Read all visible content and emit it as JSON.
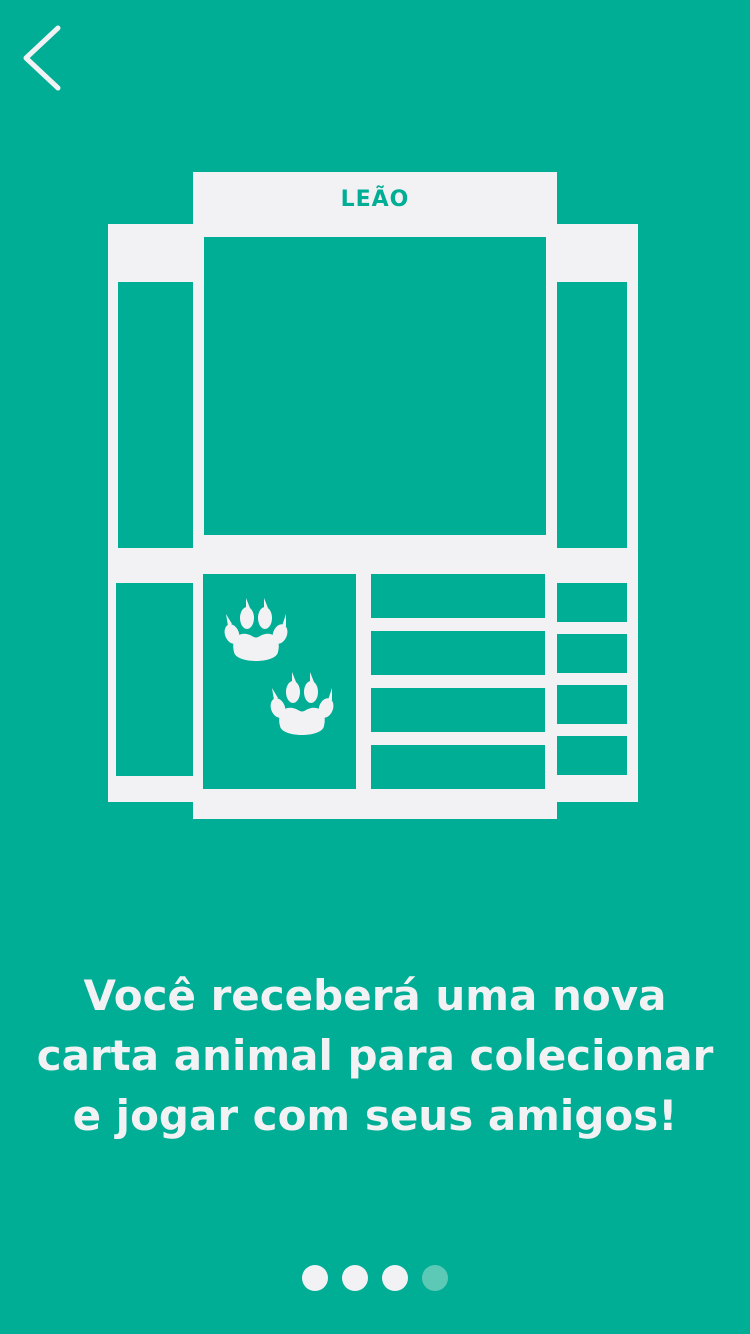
{
  "nav": {
    "back_icon": "chevron-left-icon"
  },
  "card": {
    "title": "LEÃO",
    "paw_icons": [
      "paw-print-icon",
      "paw-print-icon"
    ]
  },
  "message": {
    "line1": "Você receberá uma nova",
    "line2": "carta animal para colecionar",
    "line3": "e jogar com seus amigos!"
  },
  "pager": {
    "total_pages": 4,
    "current_page": 4
  },
  "colors": {
    "background": "#00AE95",
    "card": "#F2F2F4",
    "dot_active": "#5CC8B6"
  }
}
